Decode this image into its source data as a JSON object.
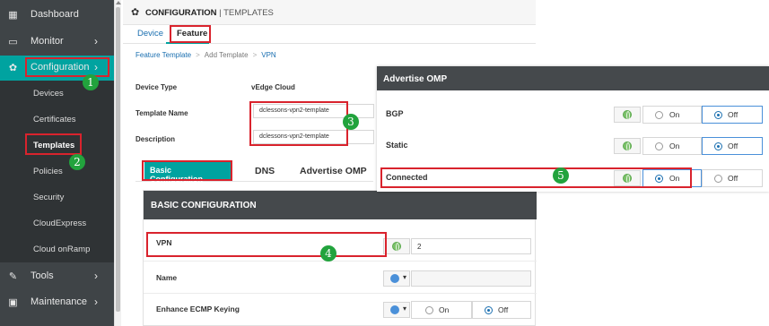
{
  "sidebar": {
    "items": [
      {
        "label": "Dashboard",
        "icon": "dashboard-icon",
        "glyph": "▦"
      },
      {
        "label": "Monitor",
        "icon": "monitor-icon",
        "glyph": "▭",
        "chevron": "›"
      },
      {
        "label": "Configuration",
        "icon": "wrench-gear-icon",
        "glyph": "✿",
        "chevron": "›"
      },
      {
        "label": "Tools",
        "icon": "tools-icon",
        "glyph": "✎",
        "chevron": "›"
      },
      {
        "label": "Maintenance",
        "icon": "maintenance-icon",
        "glyph": "▣",
        "chevron": "›"
      }
    ],
    "sub_items": [
      "Devices",
      "Certificates",
      "Templates",
      "Policies",
      "Security",
      "CloudExpress",
      "Cloud onRamp"
    ]
  },
  "header": {
    "title": "CONFIGURATION",
    "separator": " | ",
    "subtitle": "TEMPLATES",
    "tabs": [
      "Device",
      "Feature"
    ]
  },
  "breadcrumb": [
    "Feature Template",
    "Add Template",
    "VPN"
  ],
  "form": {
    "device_type_label": "Device Type",
    "device_type_value": "vEdge Cloud",
    "template_name_label": "Template Name",
    "template_name_value": "dclessons-vpn2-template",
    "description_label": "Description",
    "description_value": "dclessons-vpn2-template"
  },
  "subtabs": [
    "Basic Configuration",
    "DNS",
    "Advertise OMP"
  ],
  "basic": {
    "heading": "BASIC CONFIGURATION",
    "vpn_label": "VPN",
    "vpn_value": "2",
    "name_label": "Name",
    "ecmp_label": "Enhance ECMP Keying",
    "on": "On",
    "off": "Off"
  },
  "omp": {
    "heading": "Advertise OMP",
    "rows": [
      {
        "label": "BGP",
        "selected": "Off"
      },
      {
        "label": "Static",
        "selected": "Off"
      },
      {
        "label": "Connected",
        "selected": "On"
      }
    ],
    "on": "On",
    "off": "Off"
  },
  "steps": [
    "1",
    "2",
    "3",
    "4",
    "5"
  ],
  "colors": {
    "accent": "#00a3a0",
    "sidebar": "#3f4447",
    "highlight": "#d9232d",
    "step_badge": "#22a33d"
  }
}
